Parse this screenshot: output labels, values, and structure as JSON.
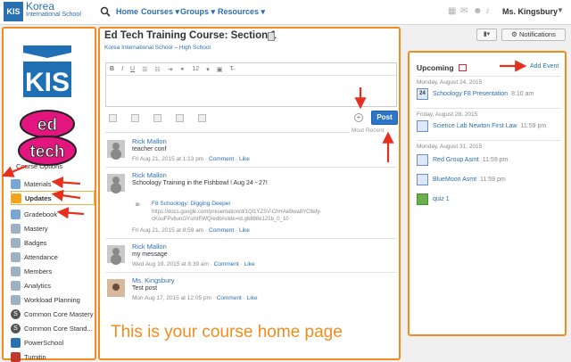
{
  "topbar": {
    "logo_mark": "KIS",
    "school_name": "Korea",
    "school_sub": "International School",
    "nav": [
      "Home",
      "Courses ▾",
      "Groups ▾",
      "Resources ▾"
    ],
    "user_name": "Ms. Kingsbury"
  },
  "sidebar": {
    "course_options": "Course Options",
    "items": [
      {
        "label": "Materials",
        "icon_color": "#7aa6d6"
      },
      {
        "label": "Updates",
        "icon_color": "#f2a31b"
      },
      {
        "label": "Gradebook",
        "icon_color": "#7aa6d6"
      },
      {
        "label": "Mastery",
        "icon_color": "#9fb0c3"
      },
      {
        "label": "Badges",
        "icon_color": "#9fb0c3"
      },
      {
        "label": "Attendance",
        "icon_color": "#9fb0c3"
      },
      {
        "label": "Members",
        "icon_color": "#9fb0c3"
      },
      {
        "label": "Analytics",
        "icon_color": "#9fb0c3"
      },
      {
        "label": "Workload Planning",
        "icon_color": "#9fb0c3"
      },
      {
        "label": "Common Core Mastery",
        "icon_color": "#555555"
      },
      {
        "label": "Common Core Stand...",
        "icon_color": "#555555"
      },
      {
        "label": "PowerSchool",
        "icon_color": "#2a6fb0"
      },
      {
        "label": "Turnitin",
        "icon_color": "#c0392b"
      }
    ]
  },
  "main": {
    "title": "Ed Tech Training Course: Section 1",
    "subtitle": "Korea International School – High School",
    "font_size_value": "12",
    "post_label": "Post",
    "sort_label": "Most Recent",
    "caption": "This is your course home page",
    "posts": [
      {
        "author": "Rick Mallon",
        "body": "teacher conf",
        "date": "Fri Aug 21, 2015 at 1:13 pm",
        "comment": "Comment",
        "like": "Like"
      },
      {
        "author": "Rick Mallon",
        "body": "Schoology Training in the Fishbowl ! Aug 24 - 27!",
        "date": "Fri Aug 21, 2015 at 8:59 am",
        "comment": "Comment",
        "like": "Like",
        "link_title": "F8 Schoology: Digging Deeper",
        "link_url": "https://docs.google.com/presentation/d/1Ql1YZSV-ChHAeBwa8YClfefy-cKouFPv6unGYsmIFWQ/edit#slide=id.gb886e121b_0_10"
      },
      {
        "author": "Rick Mallon",
        "body": "my message",
        "date": "Wed Aug 19, 2015 at 8:39 am",
        "comment": "Comment",
        "like": "Like"
      },
      {
        "author": "Ms. Kingsbury",
        "body": "Test post",
        "date": "Mon Aug 17, 2015 at 12:05 pm",
        "comment": "Comment",
        "like": "Like"
      }
    ]
  },
  "right": {
    "notifications_label": "Notifications",
    "upcoming_title": "Upcoming",
    "add_event": "Add Event",
    "days": [
      {
        "date": "Monday, August 24, 2015",
        "events": [
          {
            "name": "Schoology F8 Presentation",
            "time": "8:10 am",
            "badge": "24"
          }
        ]
      },
      {
        "date": "Friday, August 28, 2015",
        "events": [
          {
            "name": "Science Lab Newton First Law",
            "time": "11:59 pm",
            "badge": ""
          }
        ]
      },
      {
        "date": "Monday, August 31, 2015",
        "events": [
          {
            "name": "Red Group Asmt",
            "time": "11:59 pm",
            "badge": ""
          },
          {
            "name": "BlueMoon Asmt",
            "time": "11:59 pm",
            "badge": ""
          },
          {
            "name": "quiz 1",
            "time": "",
            "badge": ""
          }
        ]
      }
    ]
  },
  "colors": {
    "accent": "#2a6fb0",
    "annotation": "#f28c1f",
    "arrow": "#e53020"
  }
}
